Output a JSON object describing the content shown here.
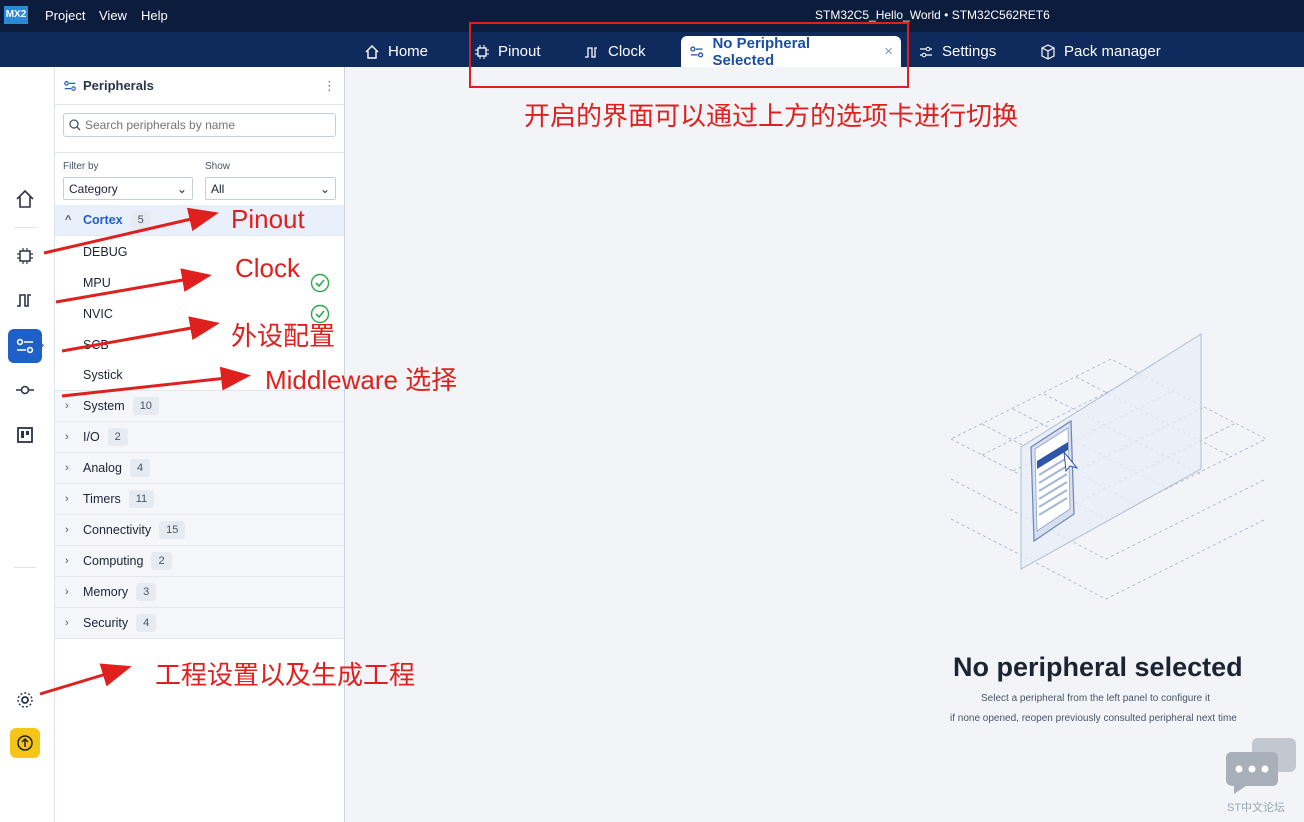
{
  "app": {
    "logo": "MX2",
    "menu": [
      "Project",
      "View",
      "Help"
    ],
    "title": "STM32C5_Hello_World  •  STM32C562RET6"
  },
  "tabs": [
    {
      "label": "Home",
      "icon": "home-icon"
    },
    {
      "label": "Pinout",
      "icon": "chip-icon"
    },
    {
      "label": "Clock",
      "icon": "clock-signal-icon"
    },
    {
      "label": "No Peripheral Selected",
      "icon": "peripheral-icon",
      "active": true
    },
    {
      "label": "Settings",
      "icon": "settings-sliders-icon"
    },
    {
      "label": "Pack manager",
      "icon": "package-icon"
    }
  ],
  "panel": {
    "title": "Peripherals",
    "search_placeholder": "Search peripherals by name",
    "filter_label": "Filter by",
    "filter_value": "Category",
    "show_label": "Show",
    "show_value": "All",
    "categories": [
      {
        "name": "Cortex",
        "count": "5",
        "open": true,
        "items": [
          "DEBUG",
          "MPU",
          "NVIC",
          "SCB",
          "Systick"
        ]
      },
      {
        "name": "System",
        "count": "10"
      },
      {
        "name": "I/O",
        "count": "2"
      },
      {
        "name": "Analog",
        "count": "4"
      },
      {
        "name": "Timers",
        "count": "11"
      },
      {
        "name": "Connectivity",
        "count": "15"
      },
      {
        "name": "Computing",
        "count": "2"
      },
      {
        "name": "Memory",
        "count": "3"
      },
      {
        "name": "Security",
        "count": "4"
      }
    ]
  },
  "main": {
    "empty_title": "No peripheral selected",
    "empty_sub1": "Select a peripheral from the left panel to configure it",
    "empty_sub2": "if none opened, reopen previously consulted peripheral next time"
  },
  "annotations": {
    "tabs_note": "开启的界面可以通过上方的选项卡进行切换",
    "pinout": "Pinout",
    "clock": "Clock",
    "peripheral": "外设配置",
    "middleware": "Middleware 选择",
    "project": "工程设置以及生成工程"
  },
  "watermark": "ST中文论坛",
  "colors": {
    "annotation": "#e0201e",
    "active_tab_text": "#1a4fa3",
    "header": "#0b1c3d",
    "accent": "#1f5fc8"
  }
}
